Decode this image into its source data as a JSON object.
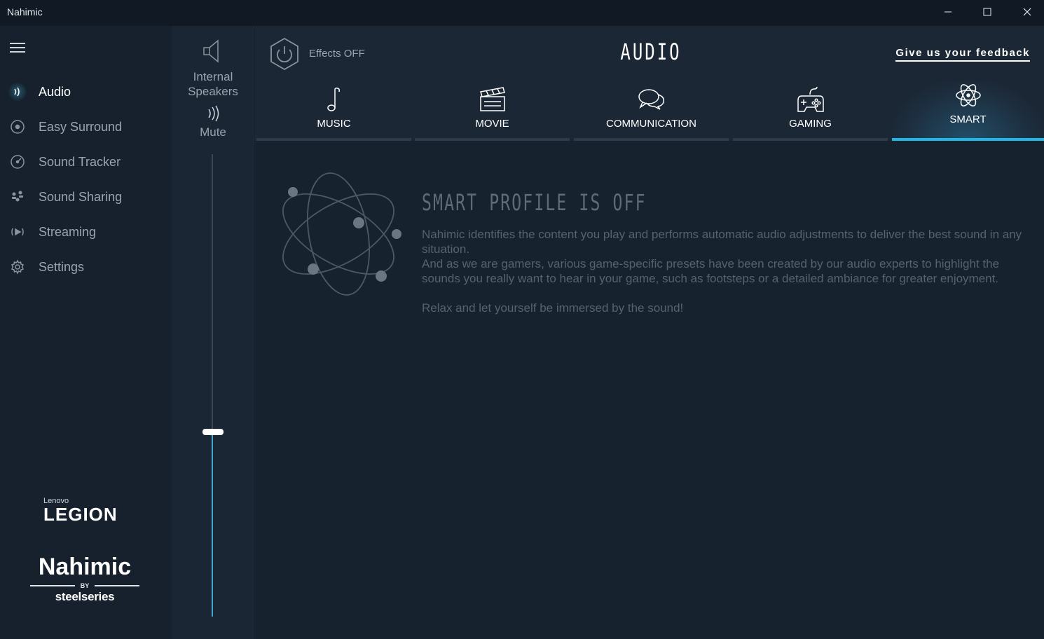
{
  "window": {
    "title": "Nahimic",
    "controls": {
      "minimize": "minimize-icon",
      "maximize": "maximize-icon",
      "close": "close-icon"
    }
  },
  "sidebar": {
    "menu_icon": "hamburger-icon",
    "items": [
      {
        "label": "Audio",
        "icon": "audio-waves-icon",
        "active": true
      },
      {
        "label": "Easy Surround",
        "icon": "surround-icon",
        "active": false
      },
      {
        "label": "Sound Tracker",
        "icon": "radar-icon",
        "active": false
      },
      {
        "label": "Sound Sharing",
        "icon": "sharing-icon",
        "active": false
      },
      {
        "label": "Streaming",
        "icon": "streaming-icon",
        "active": false
      },
      {
        "label": "Settings",
        "icon": "gear-icon",
        "active": false
      }
    ],
    "brand": {
      "legion_small": "Lenovo",
      "legion_big": "LEGION",
      "nahimic": "Nahimic",
      "by": "BY",
      "steelseries": "steelseries"
    }
  },
  "volume": {
    "device_label": "Internal Speakers",
    "mute_label": "Mute",
    "level": 0.4
  },
  "header": {
    "effects_label": "Effects OFF",
    "title": "AUDIO",
    "feedback": "Give us your feedback"
  },
  "tabs": [
    {
      "label": "MUSIC",
      "icon": "music-note-icon",
      "active": false
    },
    {
      "label": "MOVIE",
      "icon": "clapperboard-icon",
      "active": false
    },
    {
      "label": "COMMUNICATION",
      "icon": "chat-bubbles-icon",
      "active": false
    },
    {
      "label": "GAMING",
      "icon": "gamepad-icon",
      "active": false
    },
    {
      "label": "SMART",
      "icon": "atom-icon",
      "active": true
    }
  ],
  "smart": {
    "title": "SMART PROFILE IS OFF",
    "line1": "Nahimic identifies the content you play and performs automatic audio adjustments to deliver the best sound in any situation.",
    "line2": "And as we are gamers, various game-specific presets have been created by our audio experts to highlight the sounds you really want to hear in your game, such as footsteps or a detailed ambiance for greater enjoyment.",
    "line3": "Relax and let yourself be immersed by the sound!"
  },
  "colors": {
    "accent": "#1fb8e6",
    "background": "#17222f",
    "sidebar": "#16212d"
  }
}
